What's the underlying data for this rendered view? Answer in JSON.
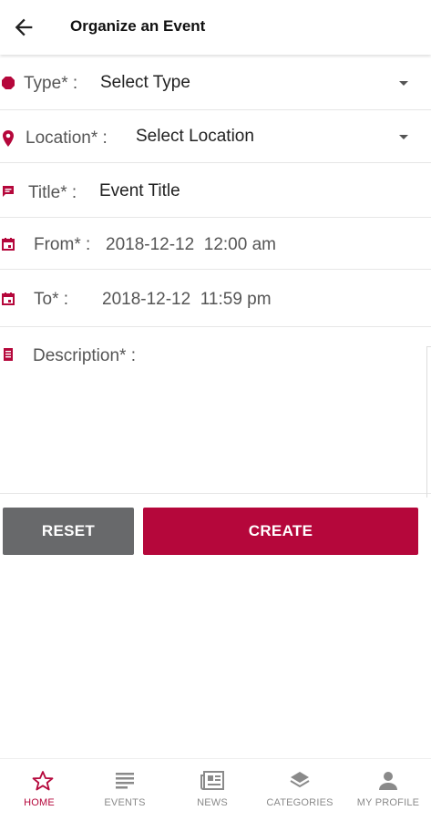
{
  "header": {
    "title": "Organize an Event"
  },
  "form": {
    "type": {
      "label": "Type* :",
      "value": "Select Type"
    },
    "location": {
      "label": "Location* :",
      "value": "Select Location"
    },
    "title": {
      "label": "Title* :",
      "value": "Event Title"
    },
    "from": {
      "label": "From* :",
      "value": "2018-12-12  12:00 am"
    },
    "to": {
      "label": "To* :",
      "value": "2018-12-12  11:59 pm"
    },
    "description": {
      "label": "Description* :"
    }
  },
  "actions": {
    "reset_label": "RESET",
    "create_label": "CREATE"
  },
  "bottom_nav": {
    "home": "HOME",
    "events": "EVENTS",
    "news": "NEWS",
    "categories": "CATEGORIES",
    "profile": "MY PROFILE"
  },
  "colors": {
    "accent": "#b5073b",
    "reset_button": "#68696b",
    "inactive": "#8a8a8a"
  },
  "icons": {
    "back": "arrow-left-icon",
    "type": "dot-icon",
    "location": "map-pin-icon",
    "title": "message-icon",
    "from": "calendar-icon",
    "to": "calendar-icon",
    "description": "document-icon",
    "home": "star-icon",
    "events": "list-icon",
    "news": "newspaper-icon",
    "categories": "layers-icon",
    "profile": "person-icon"
  }
}
